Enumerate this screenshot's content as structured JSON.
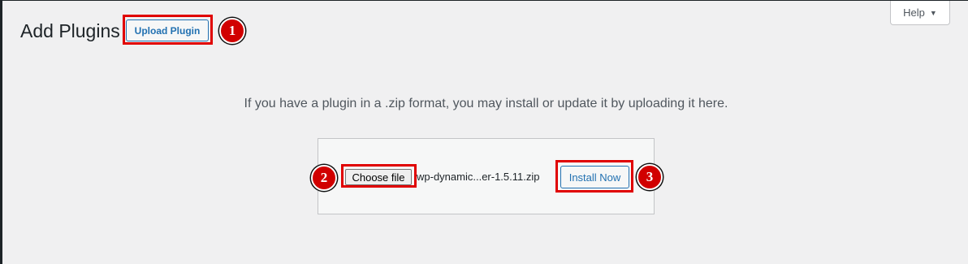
{
  "header": {
    "title": "Add Plugins",
    "upload_button_label": "Upload Plugin",
    "help_label": "Help",
    "help_caret": "▼"
  },
  "upload": {
    "intro_text": "If you have a plugin in a .zip format, you may install or update it by uploading it here.",
    "choose_file_label": "Choose file",
    "selected_file": "wp-dynamic...er-1.5.11.zip",
    "install_button_label": "Install Now"
  },
  "annotations": {
    "step1": "1",
    "step2": "2",
    "step3": "3",
    "highlight_color": "#e00000"
  },
  "colors": {
    "accent": "#2271b1",
    "background": "#f0f0f1",
    "text": "#1d2327"
  }
}
